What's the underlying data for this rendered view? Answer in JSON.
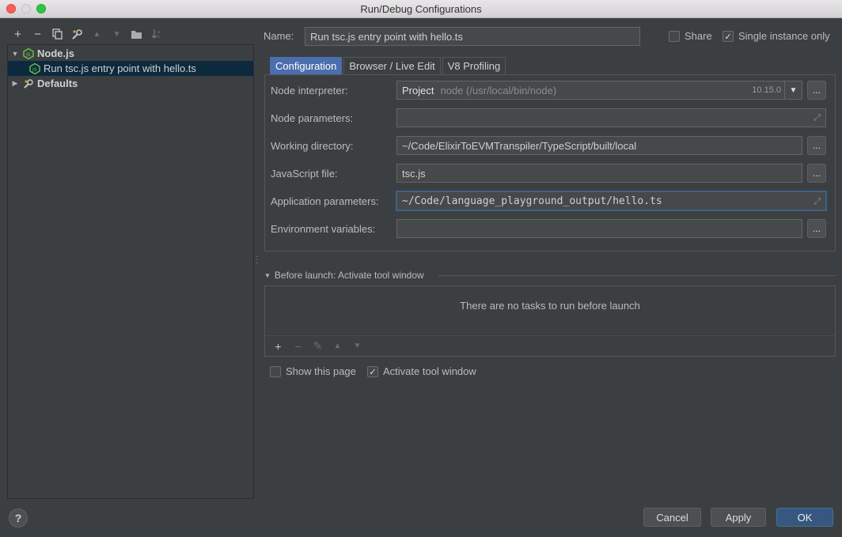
{
  "window": {
    "title": "Run/Debug Configurations"
  },
  "left_toolbar": {
    "add": "+",
    "remove": "−",
    "copy": "⎘",
    "edit": "⚙",
    "up": "▲",
    "down": "▼",
    "folder": "▬",
    "sort": "↓ᵃᶻ"
  },
  "tree": {
    "group_label": "Node.js",
    "item_label": "Run tsc.js entry point with hello.ts",
    "defaults_label": "Defaults"
  },
  "header": {
    "name_label": "Name:",
    "name_value": "Run tsc.js entry point with hello.ts",
    "share_label": "Share",
    "share_checked": false,
    "single_instance_label": "Single instance only",
    "single_instance_checked": true
  },
  "tabs": [
    {
      "label": "Configuration",
      "active": true
    },
    {
      "label": "Browser / Live Edit",
      "active": false
    },
    {
      "label": "V8 Profiling",
      "active": false
    }
  ],
  "form": {
    "node_interpreter_label": "Node interpreter:",
    "node_interpreter_project": "Project",
    "node_interpreter_path": "node (/usr/local/bin/node)",
    "node_interpreter_version": "10.15.0",
    "node_parameters_label": "Node parameters:",
    "node_parameters_value": "",
    "working_directory_label": "Working directory:",
    "working_directory_value": "~/Code/ElixirToEVMTranspiler/TypeScript/built/local",
    "javascript_file_label": "JavaScript file:",
    "javascript_file_value": "tsc.js",
    "app_params_label": "Application parameters:",
    "app_params_value": "~/Code/language_playground_output/hello.ts",
    "env_vars_label": "Environment variables:",
    "env_vars_value": "",
    "browse_label": "..."
  },
  "before_launch": {
    "title": "Before launch: Activate tool window",
    "empty_message": "There are no tasks to run before launch"
  },
  "footer": {
    "show_page_label": "Show this page",
    "show_page_checked": false,
    "activate_tool_label": "Activate tool window",
    "activate_tool_checked": true,
    "help_label": "?",
    "cancel_label": "Cancel",
    "apply_label": "Apply",
    "ok_label": "OK"
  },
  "colors": {
    "accent": "#4b6eaf",
    "ok_button": "#365880",
    "selection": "#0d293e",
    "node_green": "#6cc24a"
  }
}
